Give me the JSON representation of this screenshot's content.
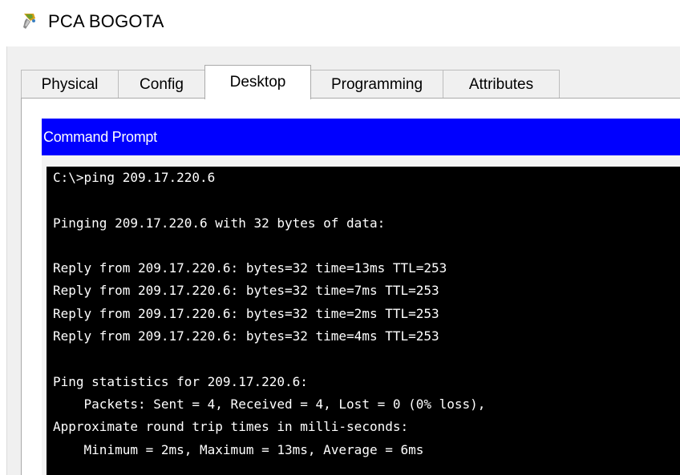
{
  "window": {
    "title": "PCA BOGOTA",
    "icon": "pc-device-icon"
  },
  "tabs": [
    {
      "label": "Physical",
      "active": false
    },
    {
      "label": "Config",
      "active": false
    },
    {
      "label": "Desktop",
      "active": true
    },
    {
      "label": "Programming",
      "active": false
    },
    {
      "label": "Attributes",
      "active": false
    }
  ],
  "command_prompt": {
    "title": "Command Prompt",
    "lines": [
      "C:\\>ping 209.17.220.6",
      "",
      "Pinging 209.17.220.6 with 32 bytes of data:",
      "",
      "Reply from 209.17.220.6: bytes=32 time=13ms TTL=253",
      "Reply from 209.17.220.6: bytes=32 time=7ms TTL=253",
      "Reply from 209.17.220.6: bytes=32 time=2ms TTL=253",
      "Reply from 209.17.220.6: bytes=32 time=4ms TTL=253",
      "",
      "Ping statistics for 209.17.220.6:",
      "    Packets: Sent = 4, Received = 4, Lost = 0 (0% loss),",
      "Approximate round trip times in milli-seconds:",
      "    Minimum = 2ms, Maximum = 13ms, Average = 6ms"
    ]
  },
  "colors": {
    "header_bg": "#0000ff",
    "terminal_bg": "#000000",
    "terminal_fg": "#ffffff"
  }
}
